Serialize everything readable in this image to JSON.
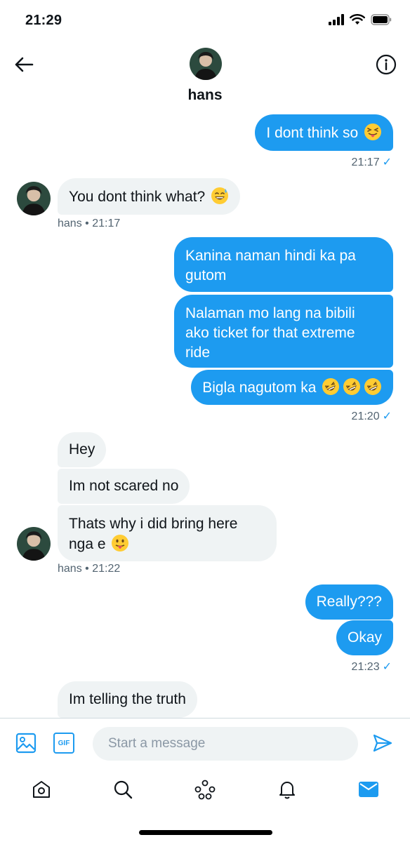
{
  "status_bar": {
    "time": "21:29"
  },
  "header": {
    "contact_name": "hans"
  },
  "messages": [
    {
      "dir": "out",
      "text": "I dont think so",
      "emoji": "squint-tongue"
    },
    {
      "dir": "out-meta",
      "time": "21:17"
    },
    {
      "dir": "in",
      "text": "You dont think what?",
      "emoji": "sweat-smile"
    },
    {
      "dir": "in-meta",
      "sender": "hans",
      "time": "21:17"
    },
    {
      "dir": "out",
      "text": "Kanina naman hindi ka pa gutom"
    },
    {
      "dir": "out",
      "text": "Nalaman mo lang na bibili ako ticket for that extreme ride"
    },
    {
      "dir": "out",
      "text": "Bigla nagutom ka",
      "emoji": "rofl x3"
    },
    {
      "dir": "out-meta",
      "time": "21:20"
    },
    {
      "dir": "in",
      "text": "Hey"
    },
    {
      "dir": "in",
      "text": "Im not scared no"
    },
    {
      "dir": "in",
      "text": "Thats why i did bring here nga e",
      "emoji": "tongue"
    },
    {
      "dir": "in-meta",
      "sender": "hans",
      "time": "21:22"
    },
    {
      "dir": "out",
      "text": "Really???"
    },
    {
      "dir": "out",
      "text": "Okay"
    },
    {
      "dir": "out-meta",
      "time": "21:23"
    },
    {
      "dir": "in",
      "text": "Im telling the truth"
    }
  ],
  "composer": {
    "placeholder": "Start a message",
    "gif_label": "GIF"
  },
  "meta_sep": "•",
  "colors": {
    "accent": "#1d9bf0",
    "incoming_bubble": "#eff3f4",
    "meta_text": "#536471"
  },
  "tabs": [
    "home-icon",
    "search-icon",
    "spaces-icon",
    "notifications-icon",
    "messages-icon"
  ]
}
